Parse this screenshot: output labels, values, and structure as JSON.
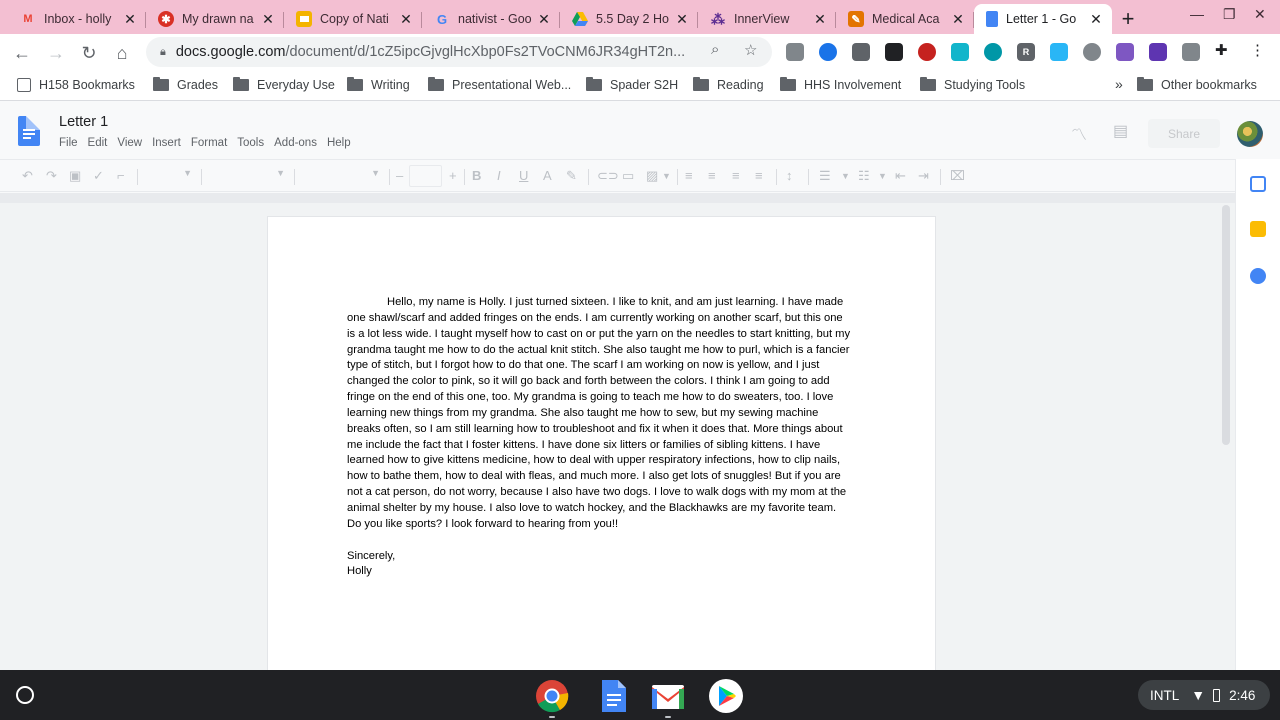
{
  "browser": {
    "tabs": [
      {
        "title": "Inbox - holly",
        "icon": "gmail-icon",
        "active": false
      },
      {
        "title": "My drawn na",
        "icon": "drawn-names-icon",
        "active": false
      },
      {
        "title": "Copy of Nati",
        "icon": "slides-icon",
        "active": false
      },
      {
        "title": "nativist - Goo",
        "icon": "google-icon",
        "active": false
      },
      {
        "title": "5.5 Day 2 Ho",
        "icon": "drive-icon",
        "active": false
      },
      {
        "title": "InnerView",
        "icon": "innerview-icon",
        "active": false
      },
      {
        "title": "Medical Aca",
        "icon": "medical-icon",
        "active": false
      },
      {
        "title": "Letter 1 - Go",
        "icon": "docs-icon",
        "active": true
      }
    ],
    "new_tab_label": "+",
    "url_host": "docs.google.com",
    "url_path": "/document/d/1cZ5ipcGjvglHcXbp0Fs2TVoCNM6JR34gHT2n...",
    "bookmarks": [
      {
        "label": "H158 Bookmarks"
      },
      {
        "label": "Grades"
      },
      {
        "label": "Everyday Use"
      },
      {
        "label": "Writing"
      },
      {
        "label": "Presentational Web..."
      },
      {
        "label": "Spader S2H"
      },
      {
        "label": "Reading"
      },
      {
        "label": "HHS Involvement"
      },
      {
        "label": "Studying Tools"
      }
    ],
    "bookmarks_overflow": "»",
    "other_bookmarks": "Other bookmarks"
  },
  "docs": {
    "title": "Letter 1",
    "menu": [
      "File",
      "Edit",
      "View",
      "Insert",
      "Format",
      "Tools",
      "Add-ons",
      "Help"
    ],
    "share_label": "Share",
    "font_size_minus": "–",
    "font_size_plus": "+",
    "bold": "B",
    "italic": "I",
    "underline": "U",
    "text_color": "A"
  },
  "document": {
    "paragraph": "Hello, my name is Holly. I just turned sixteen. I like to knit, and am just learning. I have made one shawl/scarf and added fringes on the ends. I am currently working on another scarf, but this one is a lot less wide. I taught myself how to cast on or put the yarn on the needles to start knitting, but my grandma taught me how to do the actual knit stitch. She also taught me how to purl, which is a fancier type of stitch, but I forgot how to do that one. The scarf I am working on now is yellow, and I just changed the color to pink, so it will go back and forth between the colors. I think I am going to add fringe on the end of this one, too. My grandma is going to teach me how to do sweaters, too. I love learning new things from my grandma. She also taught me how to sew, but my sewing machine breaks often, so I am still learning how to troubleshoot and fix it when it does that. More things about me include the fact that I foster kittens. I have done six litters or families of sibling kittens. I have learned how to give kittens medicine, how to deal with upper respiratory infections, how to clip nails, how to bathe them, how to deal with fleas, and much more. I also get lots of snuggles! But if you are not a cat person, do not worry, because I also have two dogs. I love to walk dogs with my mom at the animal shelter by my house. I also love to watch hockey, and the Blackhawks are my favorite team. Do you like sports? I look forward to hearing from you!!",
    "closing": "Sincerely,",
    "signature": "Holly"
  },
  "system": {
    "input_method": "INTL",
    "time": "2:46"
  },
  "colors": {
    "tabstrip": "#f3bfd2",
    "docs_blue": "#4285f4",
    "shelf": "#202124"
  }
}
